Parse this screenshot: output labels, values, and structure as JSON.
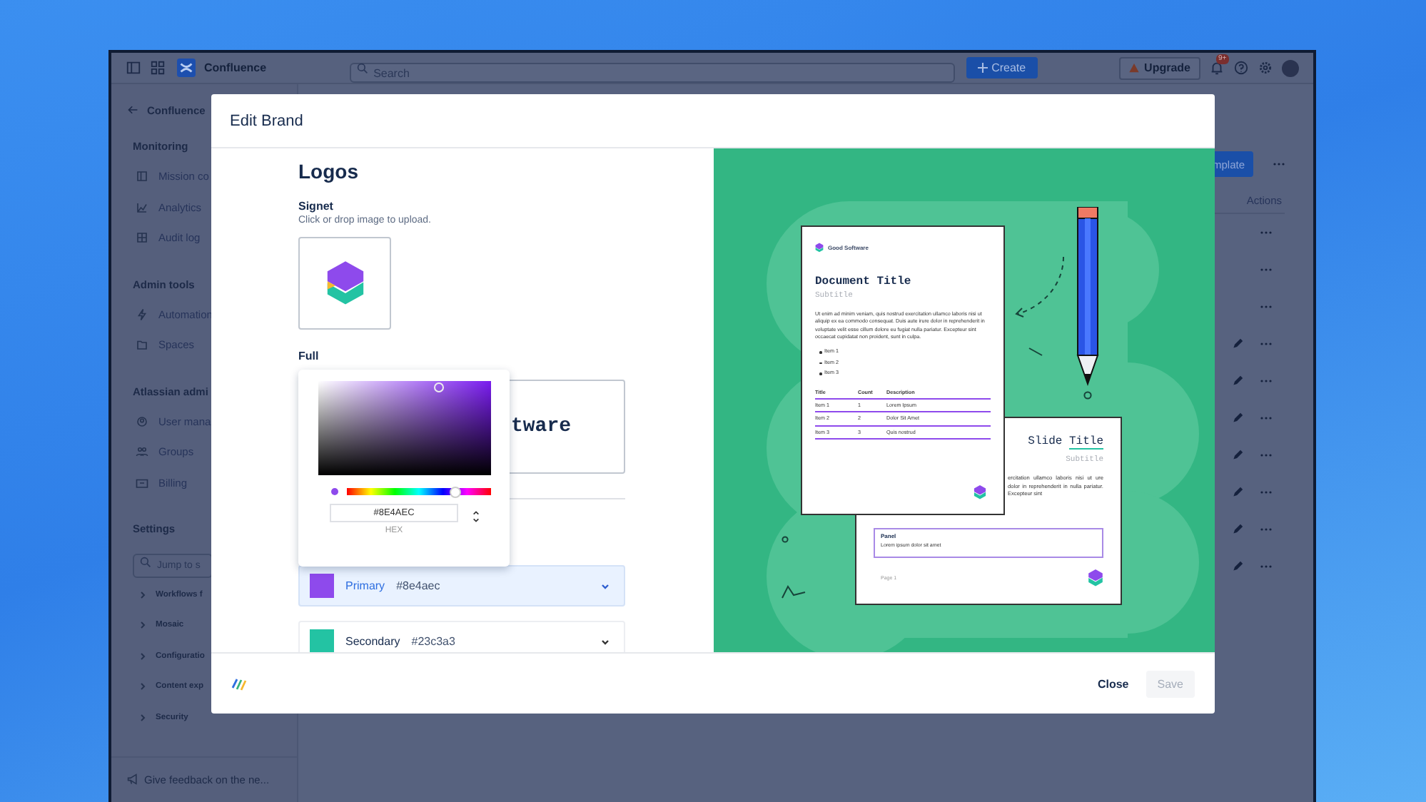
{
  "topbar": {
    "product": "Confluence",
    "search": {
      "placeholder": "Search"
    },
    "create": "Create",
    "upgrade": "Upgrade",
    "notifications_badge": "9+"
  },
  "sidebar": {
    "back": "Confluence",
    "sections": [
      {
        "title": "Monitoring",
        "items": [
          "Mission co",
          "Analytics",
          "Audit log"
        ]
      },
      {
        "title": "Admin tools",
        "items": [
          "Automation",
          "Spaces"
        ]
      },
      {
        "title": "Atlassian admi",
        "items": [
          "User mana",
          "Groups",
          "Billing"
        ]
      }
    ],
    "settings": {
      "title": "Settings",
      "search": {
        "placeholder": "Jump to s"
      },
      "items": [
        {
          "label": "Workflows f",
          "expanded": false
        },
        {
          "label": "Mosaic",
          "expanded": false
        },
        {
          "label": "Configuratio",
          "expanded": false
        },
        {
          "label": "Content exp",
          "expanded": false
        },
        {
          "label": "Security",
          "expanded": false
        }
      ]
    },
    "feedback": "Give feedback on the ne..."
  },
  "main": {
    "create_template": "mplate",
    "column": "Actions",
    "rows": [
      {
        "editable": false
      },
      {
        "editable": false
      },
      {
        "editable": false
      },
      {
        "editable": true
      },
      {
        "editable": true
      },
      {
        "editable": true
      },
      {
        "editable": true
      },
      {
        "editable": true
      },
      {
        "editable": true
      },
      {
        "editable": true
      }
    ]
  },
  "modal": {
    "title": "Edit Brand",
    "heading": "Logos",
    "signet": {
      "label": "Signet",
      "hint": "Click or drop image to upload."
    },
    "full": {
      "label": "Full",
      "logo_text": "tware"
    },
    "picker": {
      "hex": "#8E4AEC",
      "format": "HEX",
      "hue": {
        "level": 0.74
      }
    },
    "colors": [
      {
        "name": "Primary",
        "value": "#8e4aec",
        "color": "#8e4aec",
        "selected": true
      },
      {
        "name": "Secondary",
        "value": "#23c3a3",
        "color": "#23c3a3",
        "selected": false
      }
    ],
    "preview": {
      "document": {
        "brand": "Good Software",
        "title": "Document Title",
        "subtitle": "Subtitle",
        "paragraph": "Ut enim ad minim veniam, quis nostrud exercitation ullamco laboris nisi ut aliquip ex ea commodo consequat. Duis aute irure dolor in reprehenderit in voluptate velit esse cillum dolore eu fugiat nulla pariatur. Excepteur sint occaecat cupidatat non proident, sunt in culpa.",
        "list": [
          "Item 1",
          "Item 2",
          "Item 3"
        ],
        "table": {
          "columns": [
            "Title",
            "Count",
            "Description"
          ],
          "rows": [
            [
              "Item 1",
              "1",
              "Lorem Ipsum"
            ],
            [
              "Item 2",
              "2",
              "Dolor Sit Amet"
            ],
            [
              "Item 3",
              "3",
              "Quis nostrud"
            ]
          ]
        }
      },
      "slide": {
        "title_plain": "Slide",
        "title_accent": "Title",
        "subtitle": "Subtitle",
        "paragraph": "ercitation ullamco laboris nisi ut ure dolor in reprehenderit in nulla pariatur. Excepteur sint",
        "panel_title": "Panel",
        "panel_text": "Lorem ipsum dolor sit amet",
        "page": "Page 1"
      }
    },
    "footer": {
      "close": "Close",
      "save": {
        "label": "Save",
        "disabled": true
      }
    }
  }
}
